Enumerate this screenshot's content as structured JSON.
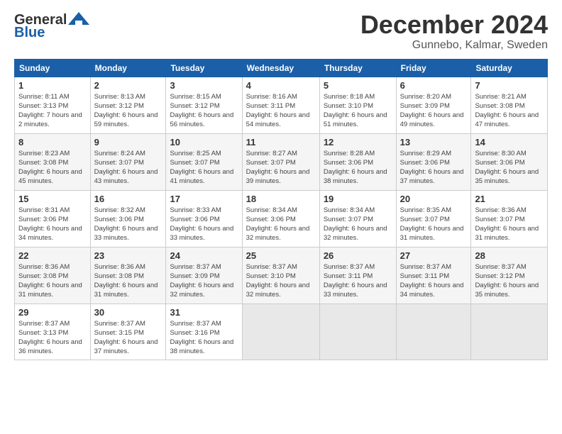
{
  "header": {
    "logo_general": "General",
    "logo_blue": "Blue",
    "month_title": "December 2024",
    "location": "Gunnebo, Kalmar, Sweden"
  },
  "days_of_week": [
    "Sunday",
    "Monday",
    "Tuesday",
    "Wednesday",
    "Thursday",
    "Friday",
    "Saturday"
  ],
  "weeks": [
    [
      {
        "day": "1",
        "sunrise": "Sunrise: 8:11 AM",
        "sunset": "Sunset: 3:13 PM",
        "daylight": "Daylight: 7 hours and 2 minutes."
      },
      {
        "day": "2",
        "sunrise": "Sunrise: 8:13 AM",
        "sunset": "Sunset: 3:12 PM",
        "daylight": "Daylight: 6 hours and 59 minutes."
      },
      {
        "day": "3",
        "sunrise": "Sunrise: 8:15 AM",
        "sunset": "Sunset: 3:12 PM",
        "daylight": "Daylight: 6 hours and 56 minutes."
      },
      {
        "day": "4",
        "sunrise": "Sunrise: 8:16 AM",
        "sunset": "Sunset: 3:11 PM",
        "daylight": "Daylight: 6 hours and 54 minutes."
      },
      {
        "day": "5",
        "sunrise": "Sunrise: 8:18 AM",
        "sunset": "Sunset: 3:10 PM",
        "daylight": "Daylight: 6 hours and 51 minutes."
      },
      {
        "day": "6",
        "sunrise": "Sunrise: 8:20 AM",
        "sunset": "Sunset: 3:09 PM",
        "daylight": "Daylight: 6 hours and 49 minutes."
      },
      {
        "day": "7",
        "sunrise": "Sunrise: 8:21 AM",
        "sunset": "Sunset: 3:08 PM",
        "daylight": "Daylight: 6 hours and 47 minutes."
      }
    ],
    [
      {
        "day": "8",
        "sunrise": "Sunrise: 8:23 AM",
        "sunset": "Sunset: 3:08 PM",
        "daylight": "Daylight: 6 hours and 45 minutes."
      },
      {
        "day": "9",
        "sunrise": "Sunrise: 8:24 AM",
        "sunset": "Sunset: 3:07 PM",
        "daylight": "Daylight: 6 hours and 43 minutes."
      },
      {
        "day": "10",
        "sunrise": "Sunrise: 8:25 AM",
        "sunset": "Sunset: 3:07 PM",
        "daylight": "Daylight: 6 hours and 41 minutes."
      },
      {
        "day": "11",
        "sunrise": "Sunrise: 8:27 AM",
        "sunset": "Sunset: 3:07 PM",
        "daylight": "Daylight: 6 hours and 39 minutes."
      },
      {
        "day": "12",
        "sunrise": "Sunrise: 8:28 AM",
        "sunset": "Sunset: 3:06 PM",
        "daylight": "Daylight: 6 hours and 38 minutes."
      },
      {
        "day": "13",
        "sunrise": "Sunrise: 8:29 AM",
        "sunset": "Sunset: 3:06 PM",
        "daylight": "Daylight: 6 hours and 37 minutes."
      },
      {
        "day": "14",
        "sunrise": "Sunrise: 8:30 AM",
        "sunset": "Sunset: 3:06 PM",
        "daylight": "Daylight: 6 hours and 35 minutes."
      }
    ],
    [
      {
        "day": "15",
        "sunrise": "Sunrise: 8:31 AM",
        "sunset": "Sunset: 3:06 PM",
        "daylight": "Daylight: 6 hours and 34 minutes."
      },
      {
        "day": "16",
        "sunrise": "Sunrise: 8:32 AM",
        "sunset": "Sunset: 3:06 PM",
        "daylight": "Daylight: 6 hours and 33 minutes."
      },
      {
        "day": "17",
        "sunrise": "Sunrise: 8:33 AM",
        "sunset": "Sunset: 3:06 PM",
        "daylight": "Daylight: 6 hours and 33 minutes."
      },
      {
        "day": "18",
        "sunrise": "Sunrise: 8:34 AM",
        "sunset": "Sunset: 3:06 PM",
        "daylight": "Daylight: 6 hours and 32 minutes."
      },
      {
        "day": "19",
        "sunrise": "Sunrise: 8:34 AM",
        "sunset": "Sunset: 3:07 PM",
        "daylight": "Daylight: 6 hours and 32 minutes."
      },
      {
        "day": "20",
        "sunrise": "Sunrise: 8:35 AM",
        "sunset": "Sunset: 3:07 PM",
        "daylight": "Daylight: 6 hours and 31 minutes."
      },
      {
        "day": "21",
        "sunrise": "Sunrise: 8:36 AM",
        "sunset": "Sunset: 3:07 PM",
        "daylight": "Daylight: 6 hours and 31 minutes."
      }
    ],
    [
      {
        "day": "22",
        "sunrise": "Sunrise: 8:36 AM",
        "sunset": "Sunset: 3:08 PM",
        "daylight": "Daylight: 6 hours and 31 minutes."
      },
      {
        "day": "23",
        "sunrise": "Sunrise: 8:36 AM",
        "sunset": "Sunset: 3:08 PM",
        "daylight": "Daylight: 6 hours and 31 minutes."
      },
      {
        "day": "24",
        "sunrise": "Sunrise: 8:37 AM",
        "sunset": "Sunset: 3:09 PM",
        "daylight": "Daylight: 6 hours and 32 minutes."
      },
      {
        "day": "25",
        "sunrise": "Sunrise: 8:37 AM",
        "sunset": "Sunset: 3:10 PM",
        "daylight": "Daylight: 6 hours and 32 minutes."
      },
      {
        "day": "26",
        "sunrise": "Sunrise: 8:37 AM",
        "sunset": "Sunset: 3:11 PM",
        "daylight": "Daylight: 6 hours and 33 minutes."
      },
      {
        "day": "27",
        "sunrise": "Sunrise: 8:37 AM",
        "sunset": "Sunset: 3:11 PM",
        "daylight": "Daylight: 6 hours and 34 minutes."
      },
      {
        "day": "28",
        "sunrise": "Sunrise: 8:37 AM",
        "sunset": "Sunset: 3:12 PM",
        "daylight": "Daylight: 6 hours and 35 minutes."
      }
    ],
    [
      {
        "day": "29",
        "sunrise": "Sunrise: 8:37 AM",
        "sunset": "Sunset: 3:13 PM",
        "daylight": "Daylight: 6 hours and 36 minutes."
      },
      {
        "day": "30",
        "sunrise": "Sunrise: 8:37 AM",
        "sunset": "Sunset: 3:15 PM",
        "daylight": "Daylight: 6 hours and 37 minutes."
      },
      {
        "day": "31",
        "sunrise": "Sunrise: 8:37 AM",
        "sunset": "Sunset: 3:16 PM",
        "daylight": "Daylight: 6 hours and 38 minutes."
      },
      null,
      null,
      null,
      null
    ]
  ]
}
